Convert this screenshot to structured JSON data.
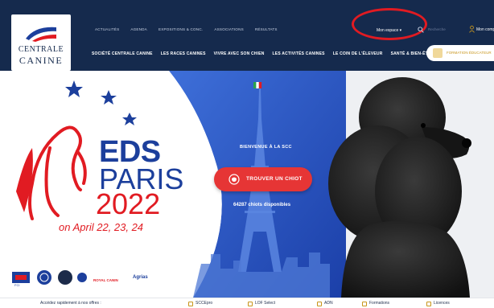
{
  "logo": {
    "line1": "CENTRALE",
    "line2": "CANINE"
  },
  "topnav": {
    "items": [
      "ACTUALITÉS",
      "AGENDA",
      "EXPOSITIONS & CONC.",
      "ASSOCIATIONS",
      "RÉSULTATS"
    ]
  },
  "account": {
    "espace_label": "Mon espace ▾",
    "search_placeholder": "Recherche",
    "user_label": "Mon compte"
  },
  "subnav": {
    "items": [
      "SOCIÉTÉ CENTRALE CANINE",
      "LES RACES CANINES",
      "VIVRE AVEC SON CHIEN",
      "LES ACTIVITÉS CANINES",
      "LE COIN DE L'ÉLEVEUR",
      "SANTÉ & BIEN-ÊTRE"
    ]
  },
  "cta": {
    "label": "FORMATION ÉDUCATEUR"
  },
  "hero": {
    "eds": "EDS",
    "paris": "PARIS",
    "year": "2022",
    "dates": "on April  22, 23, 24",
    "welcome": "BIENVENUE À LA SCC",
    "button": "TROUVER UN CHIOT",
    "count": "64287 chiots disponibles"
  },
  "partners": {
    "royal": "ROYAL CANIN",
    "agrias": "Agrias",
    "fci": "FCI"
  },
  "bottom": {
    "lead": "Accédez rapidement à nos offres :",
    "links": [
      "SCCEpro",
      "LOF Select",
      "ADN",
      "Formations",
      "Licences"
    ]
  },
  "colors": {
    "navy": "#152a4d",
    "red": "#e11b22",
    "blue": "#1c3f9c",
    "gold": "#c8951b"
  }
}
